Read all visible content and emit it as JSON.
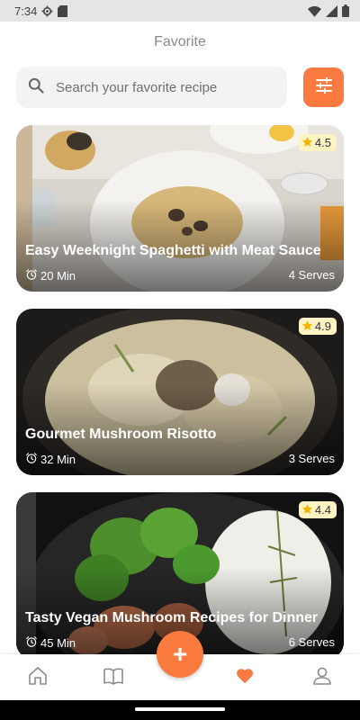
{
  "status_bar": {
    "time": "7:34",
    "icons": [
      "settings-gear-icon",
      "sd-card-icon",
      "wifi-icon",
      "signal-icon",
      "battery-icon"
    ]
  },
  "header": {
    "title": "Favorite"
  },
  "search": {
    "placeholder": "Search your favorite recipe",
    "value": ""
  },
  "filter": {
    "icon": "sliders-icon"
  },
  "colors": {
    "accent": "#fb7a3f",
    "rating_bg": "#fff3c4",
    "star": "#f5b400"
  },
  "recipes": [
    {
      "title": "Easy Weeknight Spaghetti with Meat Sauce",
      "rating": "4.5",
      "time": "20 Min",
      "serves": "4 Serves"
    },
    {
      "title": "Gourmet Mushroom Risotto",
      "rating": "4.9",
      "time": "32 Min",
      "serves": "3 Serves"
    },
    {
      "title": "Tasty Vegan Mushroom Recipes for Dinner",
      "rating": "4.4",
      "time": "45 Min",
      "serves": "6 Serves"
    }
  ],
  "bottom_nav": {
    "items": [
      {
        "icon": "home-icon",
        "active": false
      },
      {
        "icon": "book-icon",
        "active": false
      },
      {
        "icon": "add-icon",
        "active": false
      },
      {
        "icon": "heart-icon",
        "active": true
      },
      {
        "icon": "profile-icon",
        "active": false
      }
    ],
    "fab_label": "+"
  }
}
